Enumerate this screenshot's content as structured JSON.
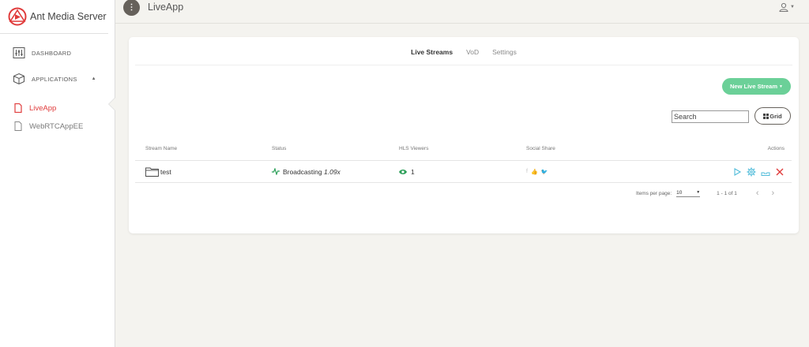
{
  "brand": {
    "name": "Ant Media Server",
    "accent": "#e03c3c"
  },
  "sidebar": {
    "items": [
      {
        "label": "DASHBOARD",
        "icon": "dashboard-icon"
      },
      {
        "label": "APPLICATIONS",
        "icon": "cube-icon"
      }
    ],
    "apps": [
      {
        "label": "LiveApp",
        "icon": "file-icon",
        "active": true
      },
      {
        "label": "WebRTCAppEE",
        "icon": "file-icon",
        "active": false
      }
    ]
  },
  "header": {
    "title": "LiveApp",
    "menu_icon": "more-vertical-icon",
    "user_icon": "user-icon"
  },
  "tabs": [
    "Live Streams",
    "VoD",
    "Settings"
  ],
  "toolbar": {
    "new_stream": "New Live Stream",
    "search_placeholder": "Search",
    "grid": "Grid",
    "success_color": "#6bd098"
  },
  "table": {
    "headers": [
      "Stream Name",
      "Status",
      "HLS Viewers",
      "Social Share",
      "Actions"
    ],
    "rows": [
      {
        "name": "test",
        "status": "Broadcasting",
        "speed": "1.09x",
        "viewers": "1"
      }
    ]
  },
  "pagination": {
    "label": "Items per page:",
    "per_page": "10",
    "range": "1 - 1 of 1"
  }
}
